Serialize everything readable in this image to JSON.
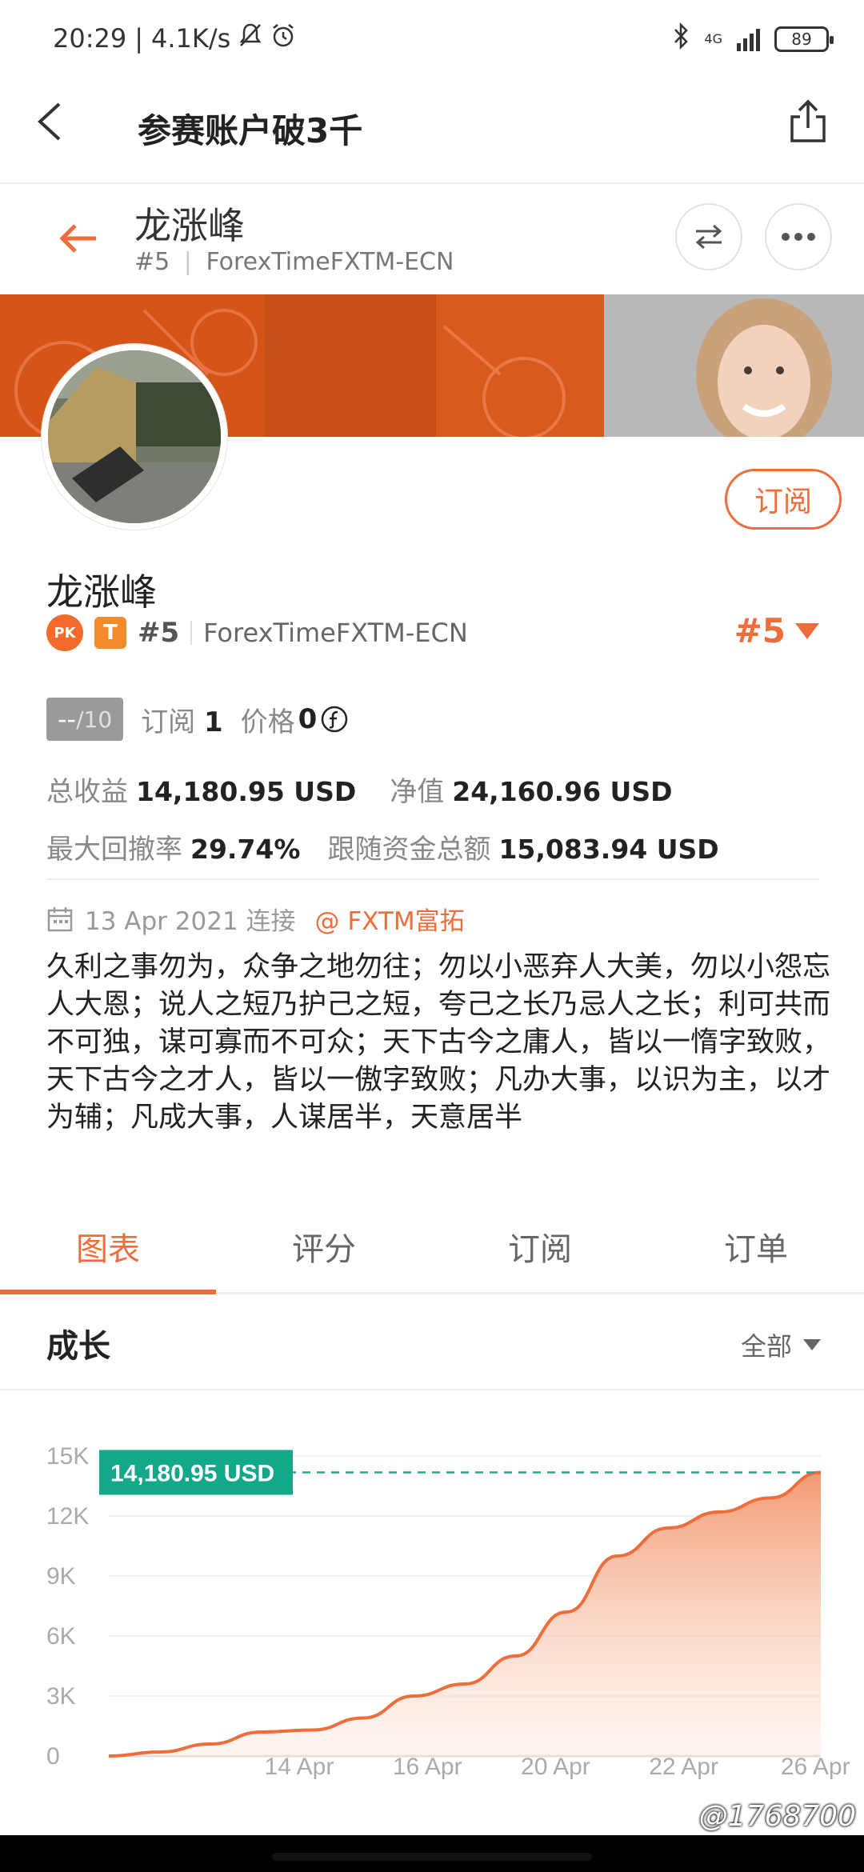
{
  "status_bar": {
    "time": "20:29",
    "speed": "4.1K/s",
    "network": "4G",
    "battery": "89"
  },
  "header": {
    "title": "参赛账户破3千"
  },
  "profile_header": {
    "name": "龙涨峰",
    "rank": "#5",
    "broker": "ForexTimeFXTM-ECN"
  },
  "profile": {
    "name": "龙涨峰",
    "subscribe_label": "订阅",
    "pk_badge": "PK",
    "tier_badge": "T",
    "rank": "#5",
    "broker": "ForexTimeFXTM-ECN",
    "rank_dropdown": "#5",
    "score": "--",
    "score_max": "/10",
    "subscribe_count_label": "订阅",
    "subscribe_count": "1",
    "price_label": "价格",
    "price": "0"
  },
  "stats": {
    "total_profit_label": "总收益",
    "total_profit": "14,180.95 USD",
    "net_value_label": "净值",
    "net_value": "24,160.96 USD",
    "max_drawdown_label": "最大回撤率",
    "max_drawdown": "29.74%",
    "follow_total_label": "跟随资金总额",
    "follow_total": "15,083.94 USD"
  },
  "connection": {
    "date": "13 Apr 2021 连接",
    "handle": "@ FXTM富拓"
  },
  "bio": "久利之事勿为，众争之地勿往；勿以小恶弃人大美，勿以小怨忘人大恩；说人之短乃护己之短，夸己之长乃忌人之长；利可共而不可独，谋可寡而不可众；天下古今之庸人，皆以一惰字致败，天下古今之才人，皆以一傲字致败；凡办大事，以识为主，以才为辅；凡成大事，人谋居半，天意居半",
  "tabs": [
    {
      "label": "图表",
      "active": true
    },
    {
      "label": "评分",
      "active": false
    },
    {
      "label": "订阅",
      "active": false
    },
    {
      "label": "订单",
      "active": false
    }
  ],
  "growth": {
    "title": "成长",
    "filter": "全部"
  },
  "chart_data": {
    "type": "area",
    "title": "",
    "xlabel": "",
    "ylabel": "",
    "ylim": [
      0,
      15000
    ],
    "yticks": [
      0,
      3000,
      6000,
      9000,
      12000,
      15000
    ],
    "ytick_labels": [
      "0",
      "3K",
      "6K",
      "9K",
      "12K",
      "15K"
    ],
    "x_tick_labels": [
      "14 Apr",
      "16 Apr",
      "20 Apr",
      "22 Apr",
      "26 Apr"
    ],
    "current_value_label": "14,180.95 USD",
    "current_value": 14180.95,
    "series": [
      {
        "values": [
          0,
          200,
          600,
          1200,
          1300,
          1900,
          3000,
          3600,
          5000,
          7200,
          10000,
          11400,
          12200,
          12900,
          14180.95
        ]
      }
    ],
    "colors": {
      "line": "#ee6d3a",
      "fill_top": "#f39a72",
      "label_bg": "#13a88a",
      "target_line": "#2aa38b"
    }
  },
  "watermark": "@1768700"
}
